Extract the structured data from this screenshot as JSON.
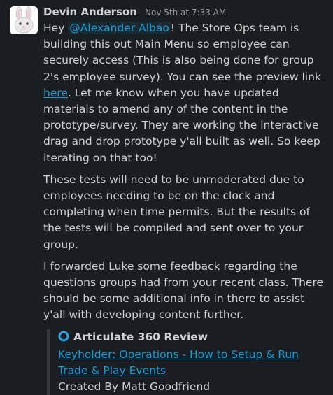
{
  "message": {
    "sender": "Devin Anderson",
    "timestamp": "Nov 5th at 7:33 AM",
    "paragraphs": {
      "p1": {
        "before_mention": "Hey ",
        "mention": "@Alexander Albao",
        "after_mention": "! The Store Ops team is building this out Main Menu so employee can securely access (This is also being done for group 2's employee survey). You can see the preview link ",
        "link_text": "here",
        "after_link": ". Let me know when you have updated materials to amend any of the content in the prototype/survey. They are working the interactive drag and drop prototype y'all built as well. So keep iterating on that too!"
      },
      "p2": "These tests will need to be unmoderated due to employees needing to be on the clock and completing when time permits. But the results of the tests will be compiled and sent over to your group.",
      "p3": "I forwarded Luke some feedback regarding the questions groups had from your recent class. There should be some additional info in there to assist y'all with developing content further."
    },
    "attachment": {
      "service_name": "Articulate 360 Review",
      "service_icon": "articulate-ring-icon",
      "title": "Keyholder: Operations - How to Setup & Run Trade & Play Events",
      "footer": "Created By Matt Goodfriend"
    }
  },
  "colors": {
    "background": "#1a1d21",
    "text": "#d1d2d3",
    "link": "#1d9bd1",
    "timestamp": "#9a9b9d",
    "attachment_bar": "#35373b"
  }
}
